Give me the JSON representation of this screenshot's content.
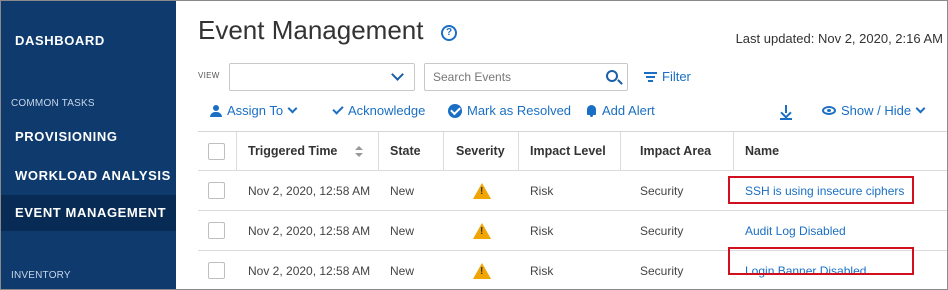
{
  "sidebar": {
    "dashboard": "DASHBOARD",
    "common_tasks": "COMMON TASKS",
    "provisioning": "PROVISIONING",
    "workload_analysis": "WORKLOAD ANALYSIS",
    "event_management": "EVENT MANAGEMENT",
    "inventory": "INVENTORY"
  },
  "header": {
    "title": "Event Management",
    "help_glyph": "?",
    "last_updated": "Last updated: Nov 2, 2020, 2:16 AM"
  },
  "filters": {
    "view_label": "VIEW",
    "view_value": "",
    "search_placeholder": "Search Events",
    "filter_label": "Filter"
  },
  "toolbar": {
    "assign_to": "Assign To",
    "acknowledge": "Acknowledge",
    "mark_resolved": "Mark as Resolved",
    "add_alert": "Add Alert",
    "show_hide": "Show / Hide"
  },
  "table": {
    "columns": [
      "Triggered Time",
      "State",
      "Severity",
      "Impact Level",
      "Impact Area",
      "Name"
    ],
    "rows": [
      {
        "time": "Nov 2, 2020, 12:58 AM",
        "state": "New",
        "severity": "warning-icon",
        "impact_level": "Risk",
        "impact_area": "Security",
        "name": "SSH is using insecure ciphers",
        "highlighted": true
      },
      {
        "time": "Nov 2, 2020, 12:58 AM",
        "state": "New",
        "severity": "warning-icon",
        "impact_level": "Risk",
        "impact_area": "Security",
        "name": "Audit Log Disabled",
        "highlighted": false
      },
      {
        "time": "Nov 2, 2020, 12:58 AM",
        "state": "New",
        "severity": "warning-icon",
        "impact_level": "Risk",
        "impact_area": "Security",
        "name": "Login Banner Disabled",
        "highlighted": true
      }
    ]
  },
  "colors": {
    "sidebar_bg": "#0e3a6e",
    "sidebar_active": "#082b55",
    "accent": "#1a6fc4",
    "warning": "#f0a500",
    "highlight": "#d0101e"
  }
}
